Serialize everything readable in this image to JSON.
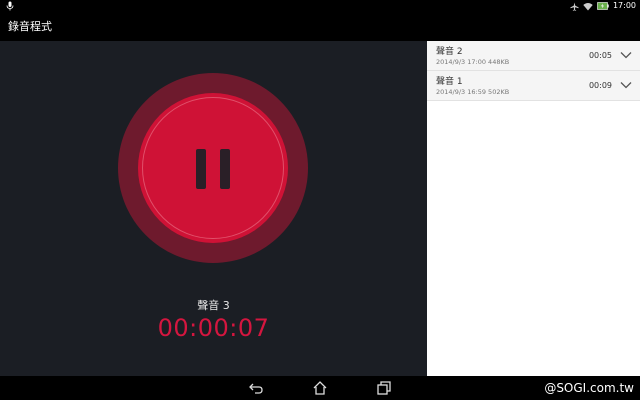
{
  "status_bar": {
    "time": "17:00"
  },
  "app": {
    "title": "錄音程式"
  },
  "recorder": {
    "current_name": "聲音 3",
    "elapsed": "00:00:07",
    "accent_color": "#d4163f"
  },
  "recordings": [
    {
      "name": "聲音 2",
      "meta": "2014/9/3 17:00   448KB",
      "duration": "00:05"
    },
    {
      "name": "聲音 1",
      "meta": "2014/9/3 16:59   502KB",
      "duration": "00:09"
    }
  ],
  "nav": {
    "buttons": [
      "back-icon",
      "home-icon",
      "recent-apps-icon"
    ]
  },
  "watermark": "@SOGI.com.tw"
}
